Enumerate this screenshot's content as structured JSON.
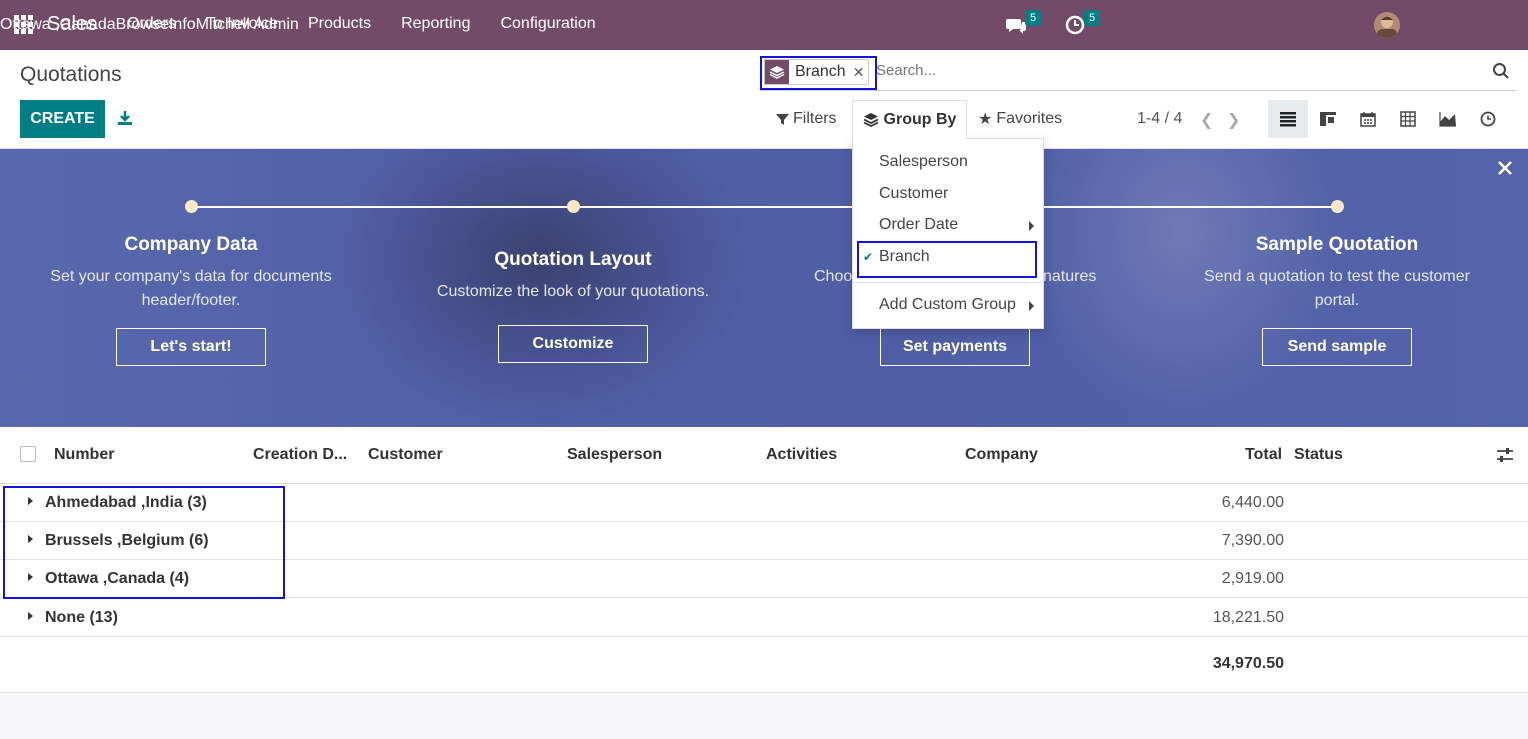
{
  "navbar": {
    "brand": "Sales",
    "menu": [
      "Orders",
      "To Invoice",
      "Products",
      "Reporting",
      "Configuration"
    ],
    "messages_count": "5",
    "activities_count": "5",
    "branch": "Ottawa ,Canada",
    "company": "BrowseInfo",
    "user": "Mitchell Admin"
  },
  "control": {
    "title": "Quotations",
    "create_label": "CREATE",
    "search_facet": "Branch",
    "search_placeholder": "Search...",
    "filters_label": "Filters",
    "groupby_label": "Group By",
    "favorites_label": "Favorites",
    "pager": "1-4 / 4"
  },
  "groupby_menu": {
    "items": [
      "Salesperson",
      "Customer",
      "Order Date",
      "Branch",
      "Add Custom Group"
    ],
    "selected": "Branch"
  },
  "banner": {
    "steps": [
      {
        "title": "Company Data",
        "desc": "Set your company's data for documents header/footer.",
        "button": "Let's start!"
      },
      {
        "title": "Quotation Layout",
        "desc": "Customize the look of your quotations.",
        "button": "Customize"
      },
      {
        "title": "",
        "desc_left": "Choo",
        "desc_right": "natures",
        "button": "Set payments"
      },
      {
        "title": "Sample Quotation",
        "desc": "Send a quotation to test the customer portal.",
        "button": "Send sample"
      }
    ]
  },
  "list": {
    "columns": [
      "Number",
      "Creation D...",
      "Customer",
      "Salesperson",
      "Activities",
      "Company",
      "Total",
      "Status"
    ],
    "groups": [
      {
        "name": "Ahmedabad ,India (3)",
        "total": "6,440.00"
      },
      {
        "name": "Brussels ,Belgium (6)",
        "total": "7,390.00"
      },
      {
        "name": "Ottawa ,Canada (4)",
        "total": "2,919.00"
      },
      {
        "name": "None (13)",
        "total": "18,221.50"
      }
    ],
    "grand_total": "34,970.50"
  },
  "colors": {
    "navbar": "#714b67",
    "primary": "#017e84",
    "highlight": "#1414d9"
  }
}
